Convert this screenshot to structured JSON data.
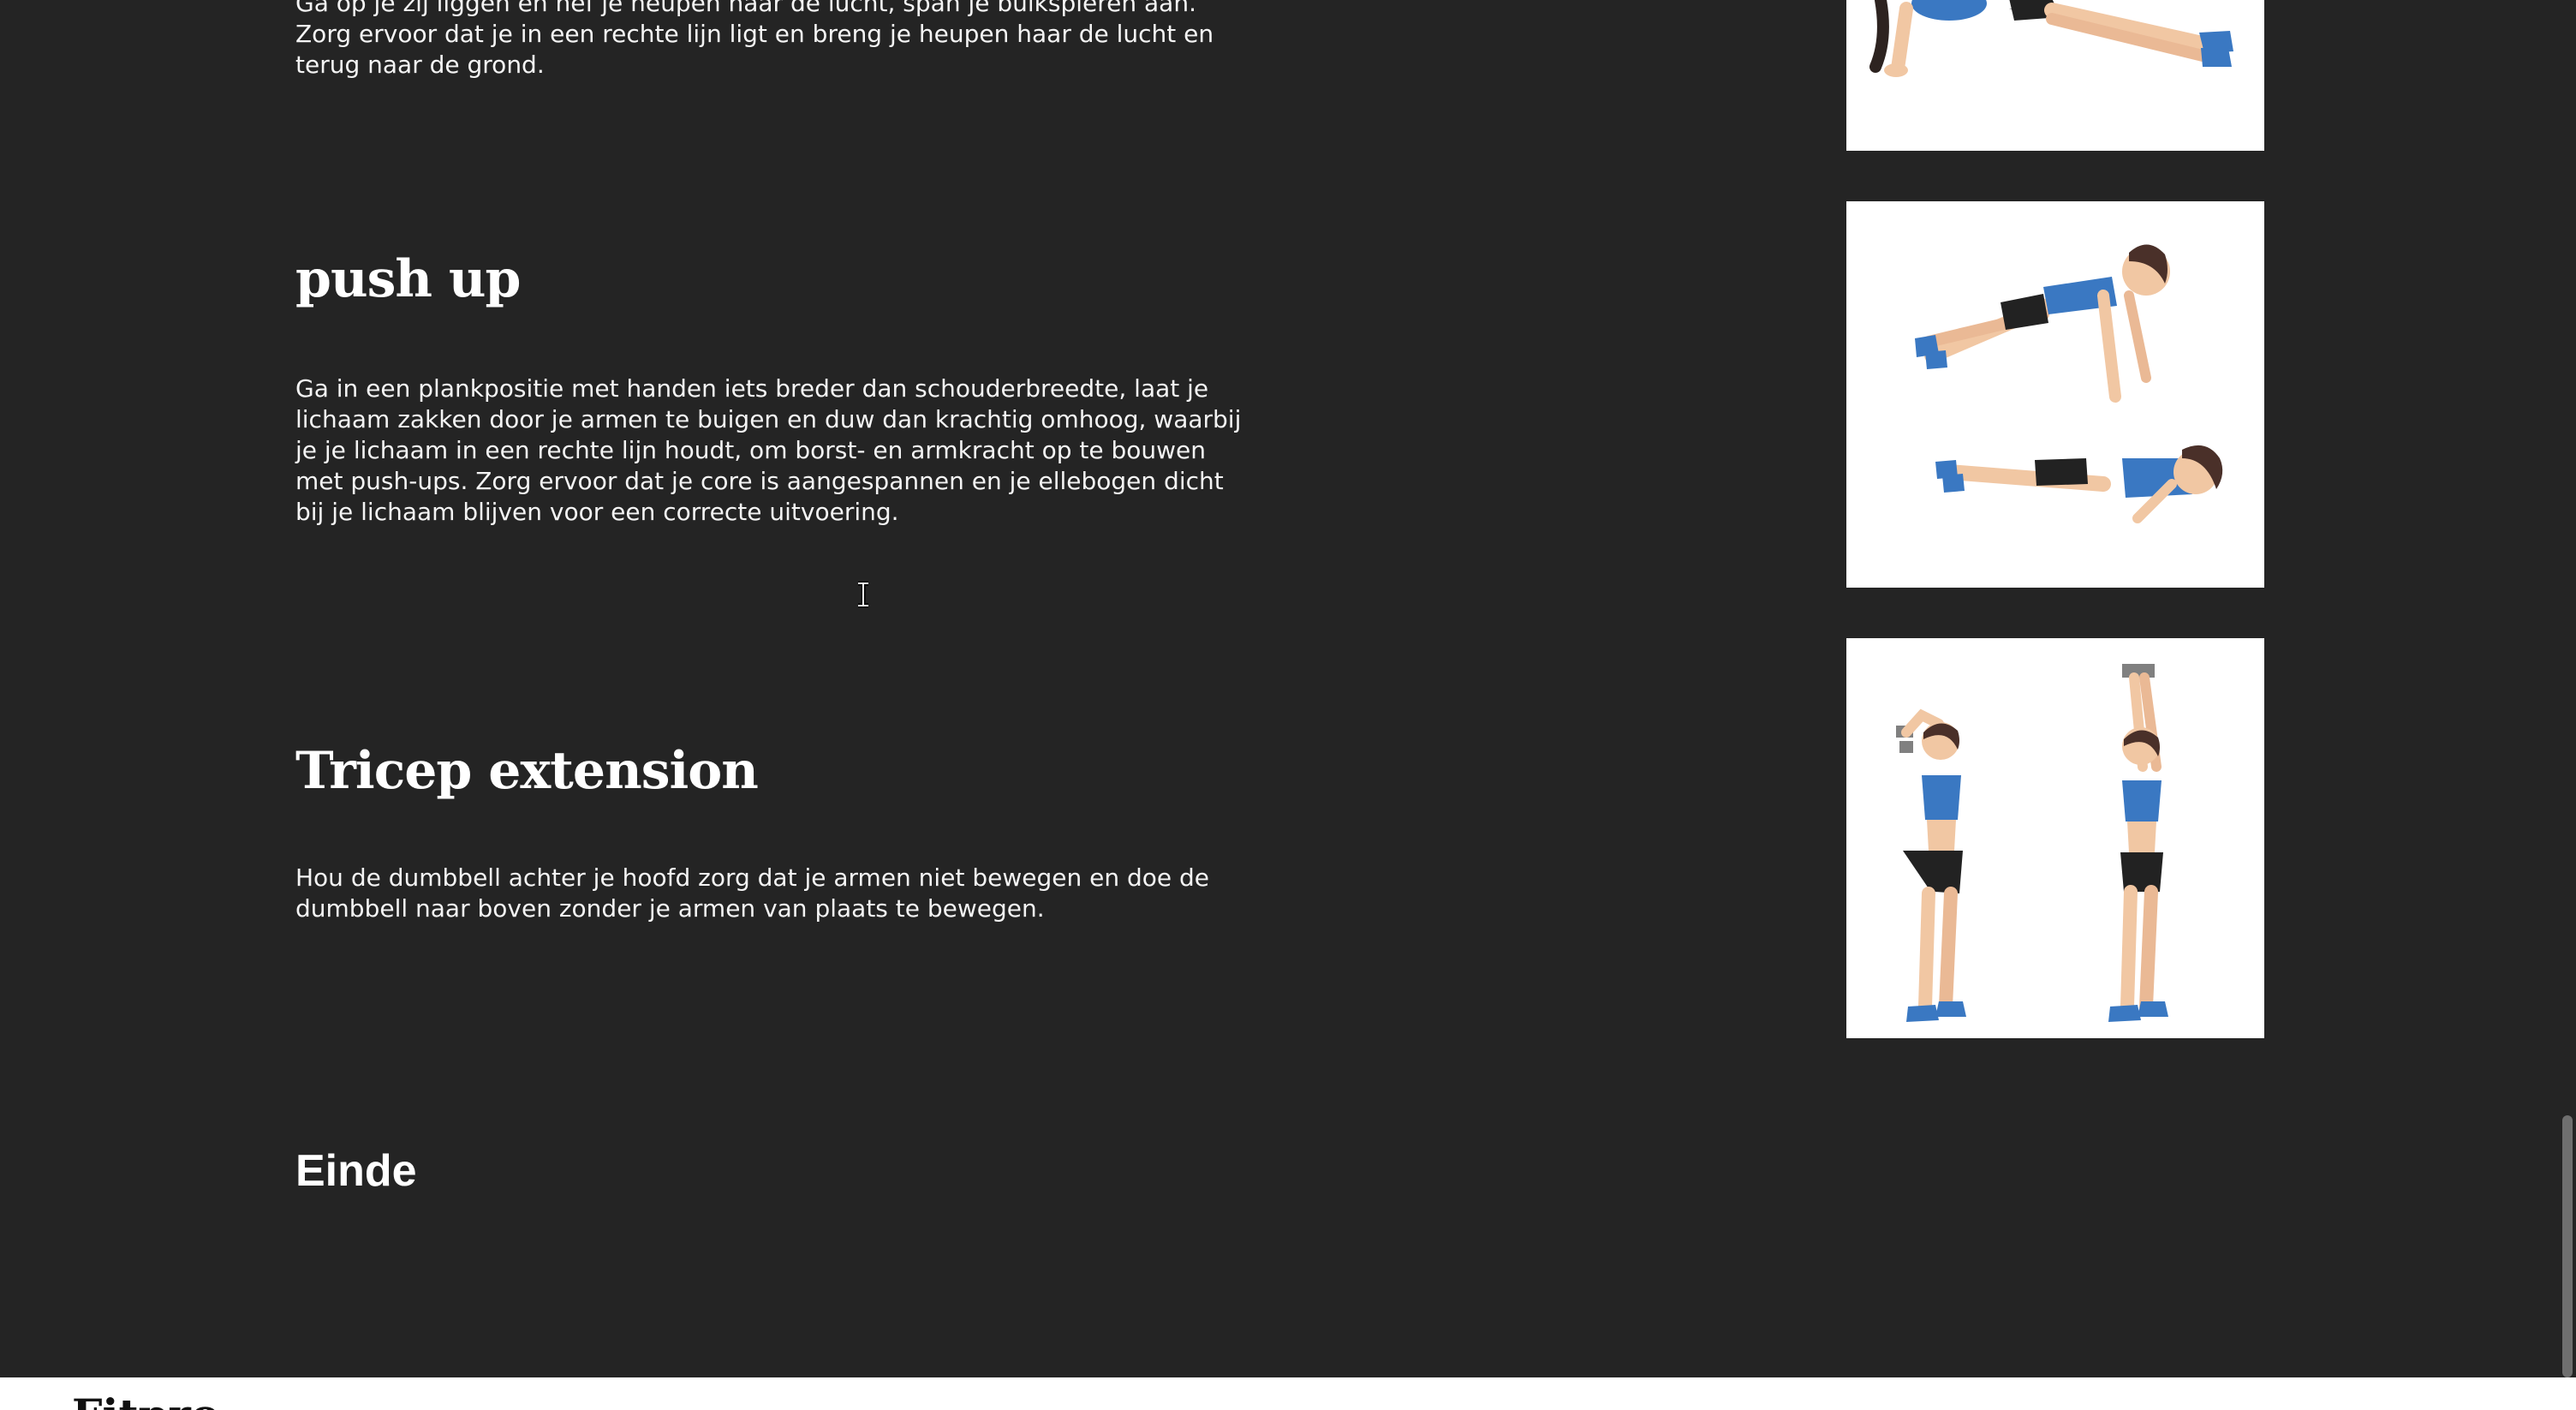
{
  "window": {
    "title": "Fitpro"
  },
  "exercises": [
    {
      "title": "",
      "description": "Ga op je zij liggen en hef je heupen naar de lucht, span je buikspieren aan. Zorg ervoor dat je in een rechte lijn ligt en breng je heupen haar de lucht en terug naar de grond.",
      "image": "side-plank-illustration"
    },
    {
      "title": "push up",
      "description": "Ga in een plankpositie met handen iets breder dan schouderbreedte, laat je lichaam zakken door je armen te buigen en duw dan krachtig omhoog, waarbij je je lichaam in een rechte lijn houdt, om borst- en armkracht op te bouwen met push-ups. Zorg ervoor dat je core is aangespannen en je ellebogen dicht bij je lichaam blijven voor een correcte uitvoering.",
      "image": "push-up-illustration"
    },
    {
      "title": "Tricep extension",
      "description": "Hou de dumbbell achter je hoofd zorg dat je armen niet bewegen en doe de dumbbell naar boven zonder je armen van plaats te bewegen.",
      "image": "tricep-extension-illustration"
    }
  ],
  "end_label": "Einde",
  "footer": {
    "logo": "Fitpro"
  },
  "colors": {
    "background": "#242424",
    "text": "#ffffff",
    "accent_blue": "#3a78c2",
    "card_background": "#ffffff"
  }
}
